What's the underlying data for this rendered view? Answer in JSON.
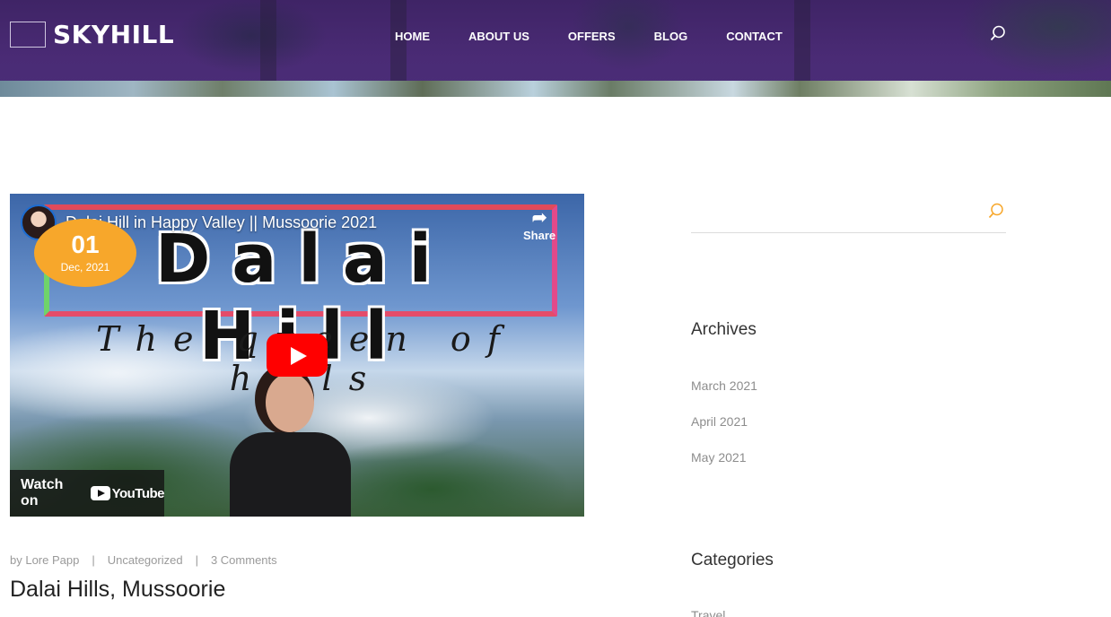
{
  "header": {
    "brand": "SKYHILL",
    "nav": [
      "HOME",
      "ABOUT US",
      "OFFERS",
      "BLOG",
      "CONTACT"
    ],
    "search_icon": "search-icon"
  },
  "video": {
    "title": "Dalai Hill in Happy Valley || Mussoorie 2021",
    "share_label": "Share",
    "thumbnail_headline": "Dalai Hill",
    "thumbnail_script": "The queen of hills",
    "watch_on": "Watch on",
    "youtube": "YouTube"
  },
  "date_badge": {
    "day": "01",
    "month": "Dec, 2021"
  },
  "post": {
    "author": "by Lore Papp",
    "category": "Uncategorized",
    "comments": "3 Comments",
    "title": "Dalai Hills, Mussoorie"
  },
  "sidebar": {
    "archives_heading": "Archives",
    "archives": [
      "March 2021",
      "April 2021",
      "May 2021"
    ],
    "categories_heading": "Categories",
    "categories_partial": "Travel"
  },
  "colors": {
    "header": "#4a2b75",
    "accent": "#f7a72b",
    "youtube_red": "#ff0000"
  }
}
